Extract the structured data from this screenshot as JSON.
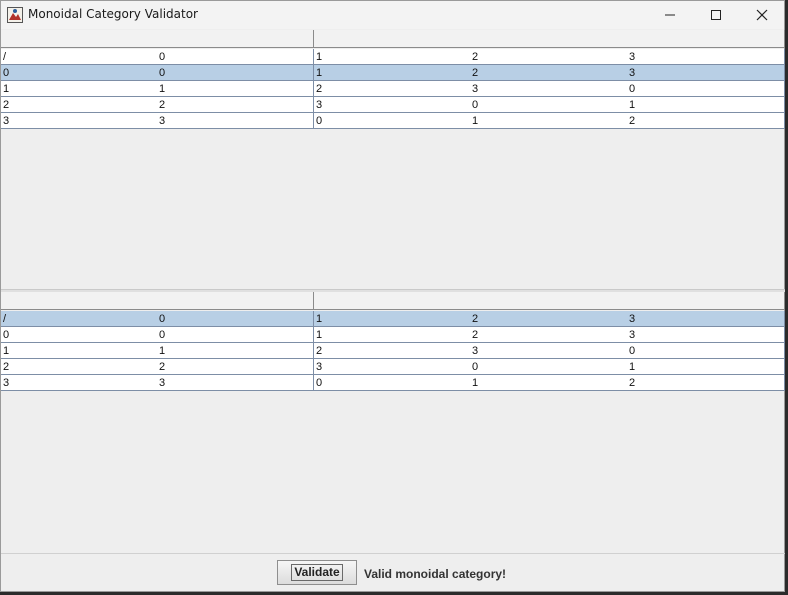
{
  "window": {
    "title": "Monoidal Category Validator"
  },
  "table_top": {
    "headers": [
      "",
      "",
      "",
      "",
      ""
    ],
    "selected_row": 1,
    "rows": [
      [
        "/",
        "0",
        "1",
        "2",
        "3"
      ],
      [
        "0",
        "0",
        "1",
        "2",
        "3"
      ],
      [
        "1",
        "1",
        "2",
        "3",
        "0"
      ],
      [
        "2",
        "2",
        "3",
        "0",
        "1"
      ],
      [
        "3",
        "3",
        "0",
        "1",
        "2"
      ]
    ]
  },
  "table_bottom": {
    "headers": [
      "",
      "",
      "",
      "",
      ""
    ],
    "selected_row": 0,
    "rows": [
      [
        "/",
        "0",
        "1",
        "2",
        "3"
      ],
      [
        "0",
        "0",
        "1",
        "2",
        "3"
      ],
      [
        "1",
        "1",
        "2",
        "3",
        "0"
      ],
      [
        "2",
        "2",
        "3",
        "0",
        "1"
      ],
      [
        "3",
        "3",
        "0",
        "1",
        "2"
      ]
    ]
  },
  "footer": {
    "validate_label": "Validate",
    "status_text": "Valid monoidal category!"
  },
  "colors": {
    "selection": "#b8cfe5",
    "grid": "#7d8ea6"
  }
}
